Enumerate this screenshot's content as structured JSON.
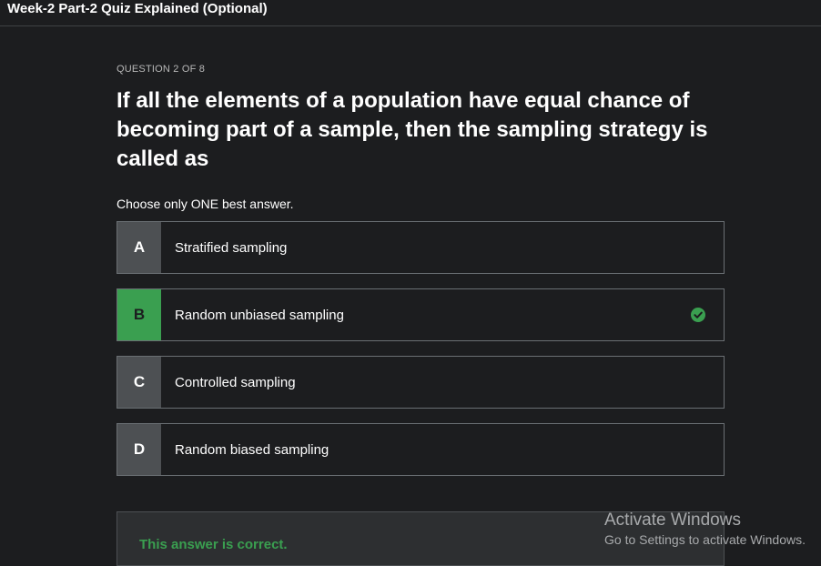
{
  "header": {
    "title": "Week-2 Part-2 Quiz Explained (Optional)"
  },
  "quiz": {
    "counter": "QUESTION 2 OF 8",
    "question": "If all the elements of a population have equal chance of becoming part of a sample, then the sampling strategy is called as",
    "instruction": "Choose only ONE best answer.",
    "options": [
      {
        "letter": "A",
        "text": "Stratified sampling",
        "state": "default"
      },
      {
        "letter": "B",
        "text": "Random unbiased sampling",
        "state": "correct",
        "icon": "check-circle-icon"
      },
      {
        "letter": "C",
        "text": "Controlled sampling",
        "state": "default"
      },
      {
        "letter": "D",
        "text": "Random biased sampling",
        "state": "default"
      }
    ],
    "feedback": "This answer is correct."
  },
  "watermark": {
    "title": "Activate Windows",
    "subtitle": "Go to Settings to activate Windows."
  },
  "colors": {
    "background": "#1c1d1f",
    "correct_green": "#3a9f50",
    "letter_box": "#4d5053",
    "border": "#6a6f73"
  }
}
